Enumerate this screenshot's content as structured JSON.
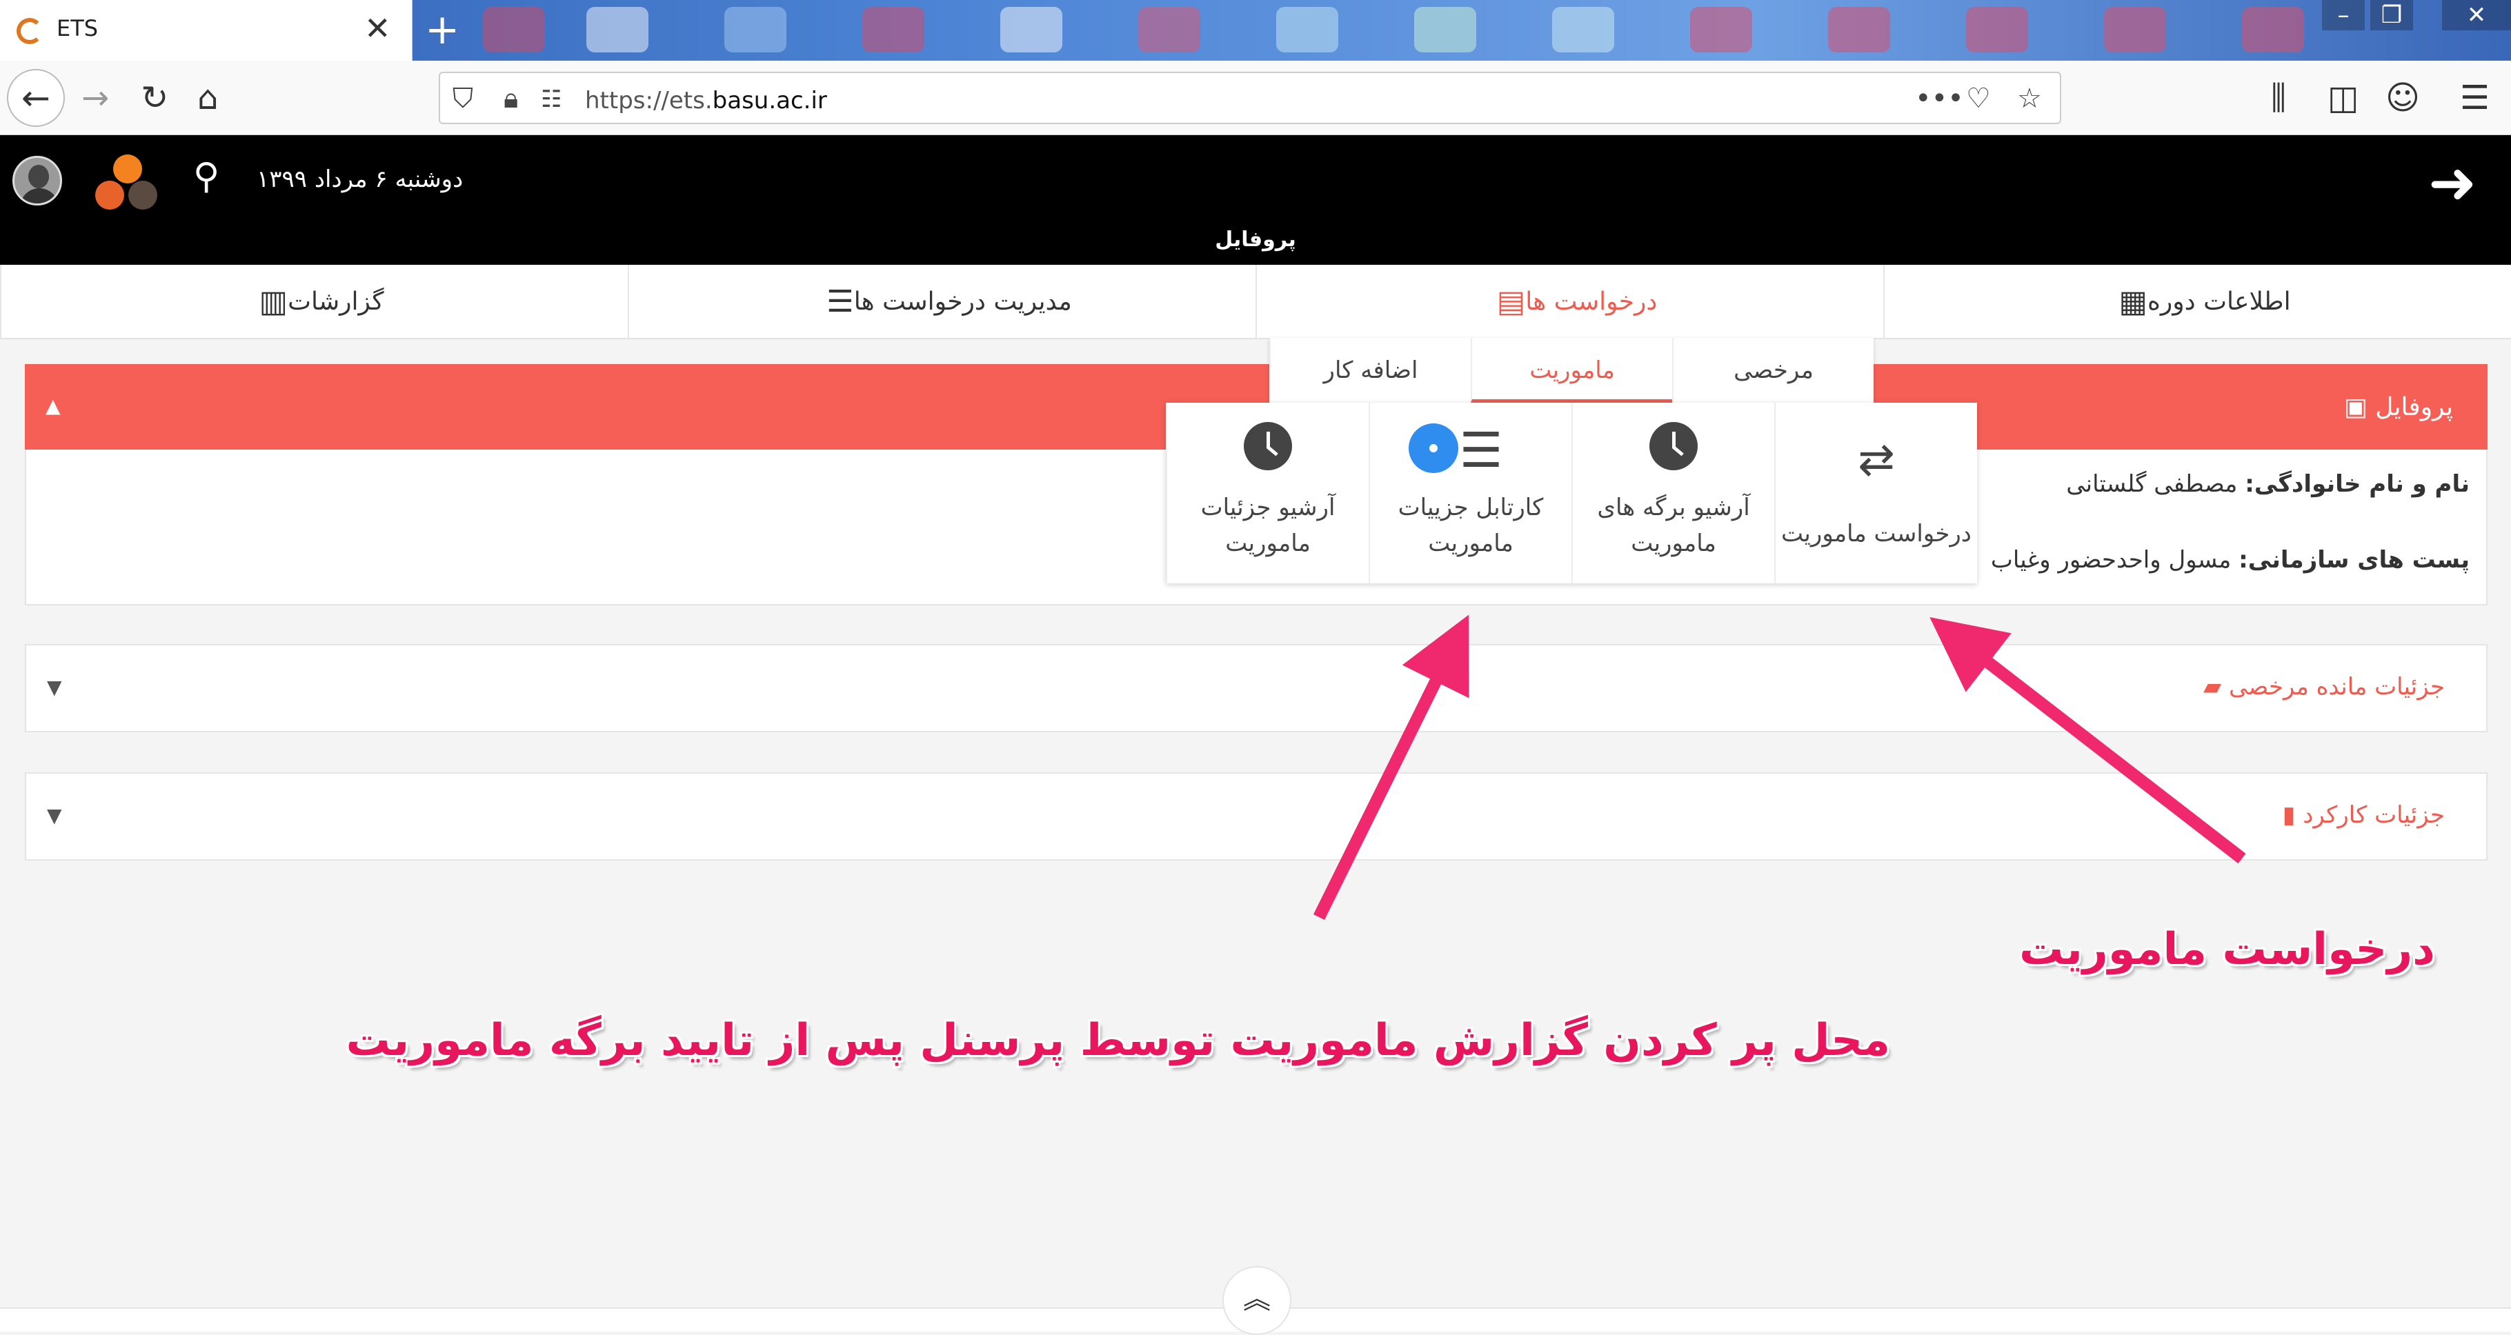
{
  "browser": {
    "tab_title": "ETS",
    "url_prefix": "https://ets.",
    "url_domain": "basu.ac.ir"
  },
  "header": {
    "date": "دوشنبه ۶ مرداد ۱۳۹۹",
    "page_title": "پروفایل"
  },
  "main_tabs": [
    {
      "label": "اطلاعات دوره",
      "icon": "calendar-icon"
    },
    {
      "label": "درخواست ها",
      "icon": "id-card-icon"
    },
    {
      "label": "مدیریت درخواست ها",
      "icon": "checklist-icon"
    },
    {
      "label": "گزارشات",
      "icon": "report-icon"
    }
  ],
  "sub_tabs": [
    {
      "label": "مرخصی"
    },
    {
      "label": "ماموریت"
    },
    {
      "label": "اضافه کار"
    }
  ],
  "dropdown_items": [
    {
      "label": "درخواست ماموریت",
      "icon": "exchange-icon"
    },
    {
      "label": "آرشیو برگه های ماموریت",
      "icon": "clock-icon"
    },
    {
      "label": "کارتابل جزییات ماموریت",
      "icon": "list-icon"
    },
    {
      "label": "آرشیو جزئیات ماموریت",
      "icon": "clock-icon"
    }
  ],
  "profile": {
    "title": "پروفایل",
    "name_label": "نام و نام خانوادگی:",
    "name_value": "مصطفی گلستانی",
    "post_label": "پست های سازمانی:",
    "post_value": "مسول واحدحضور وغیاب"
  },
  "sections": [
    {
      "title": "جزئیات مانده مرخصی"
    },
    {
      "title": "جزئیات کارکرد"
    }
  ],
  "annotations": {
    "request": "درخواست ماموریت",
    "report": "محل پر کردن گزارش ماموریت توسط پرسنل پس از تایید برگه ماموریت"
  },
  "colors": {
    "accent": "#f55f55",
    "annotation": "#e8175d",
    "header_bg": "#000000"
  }
}
